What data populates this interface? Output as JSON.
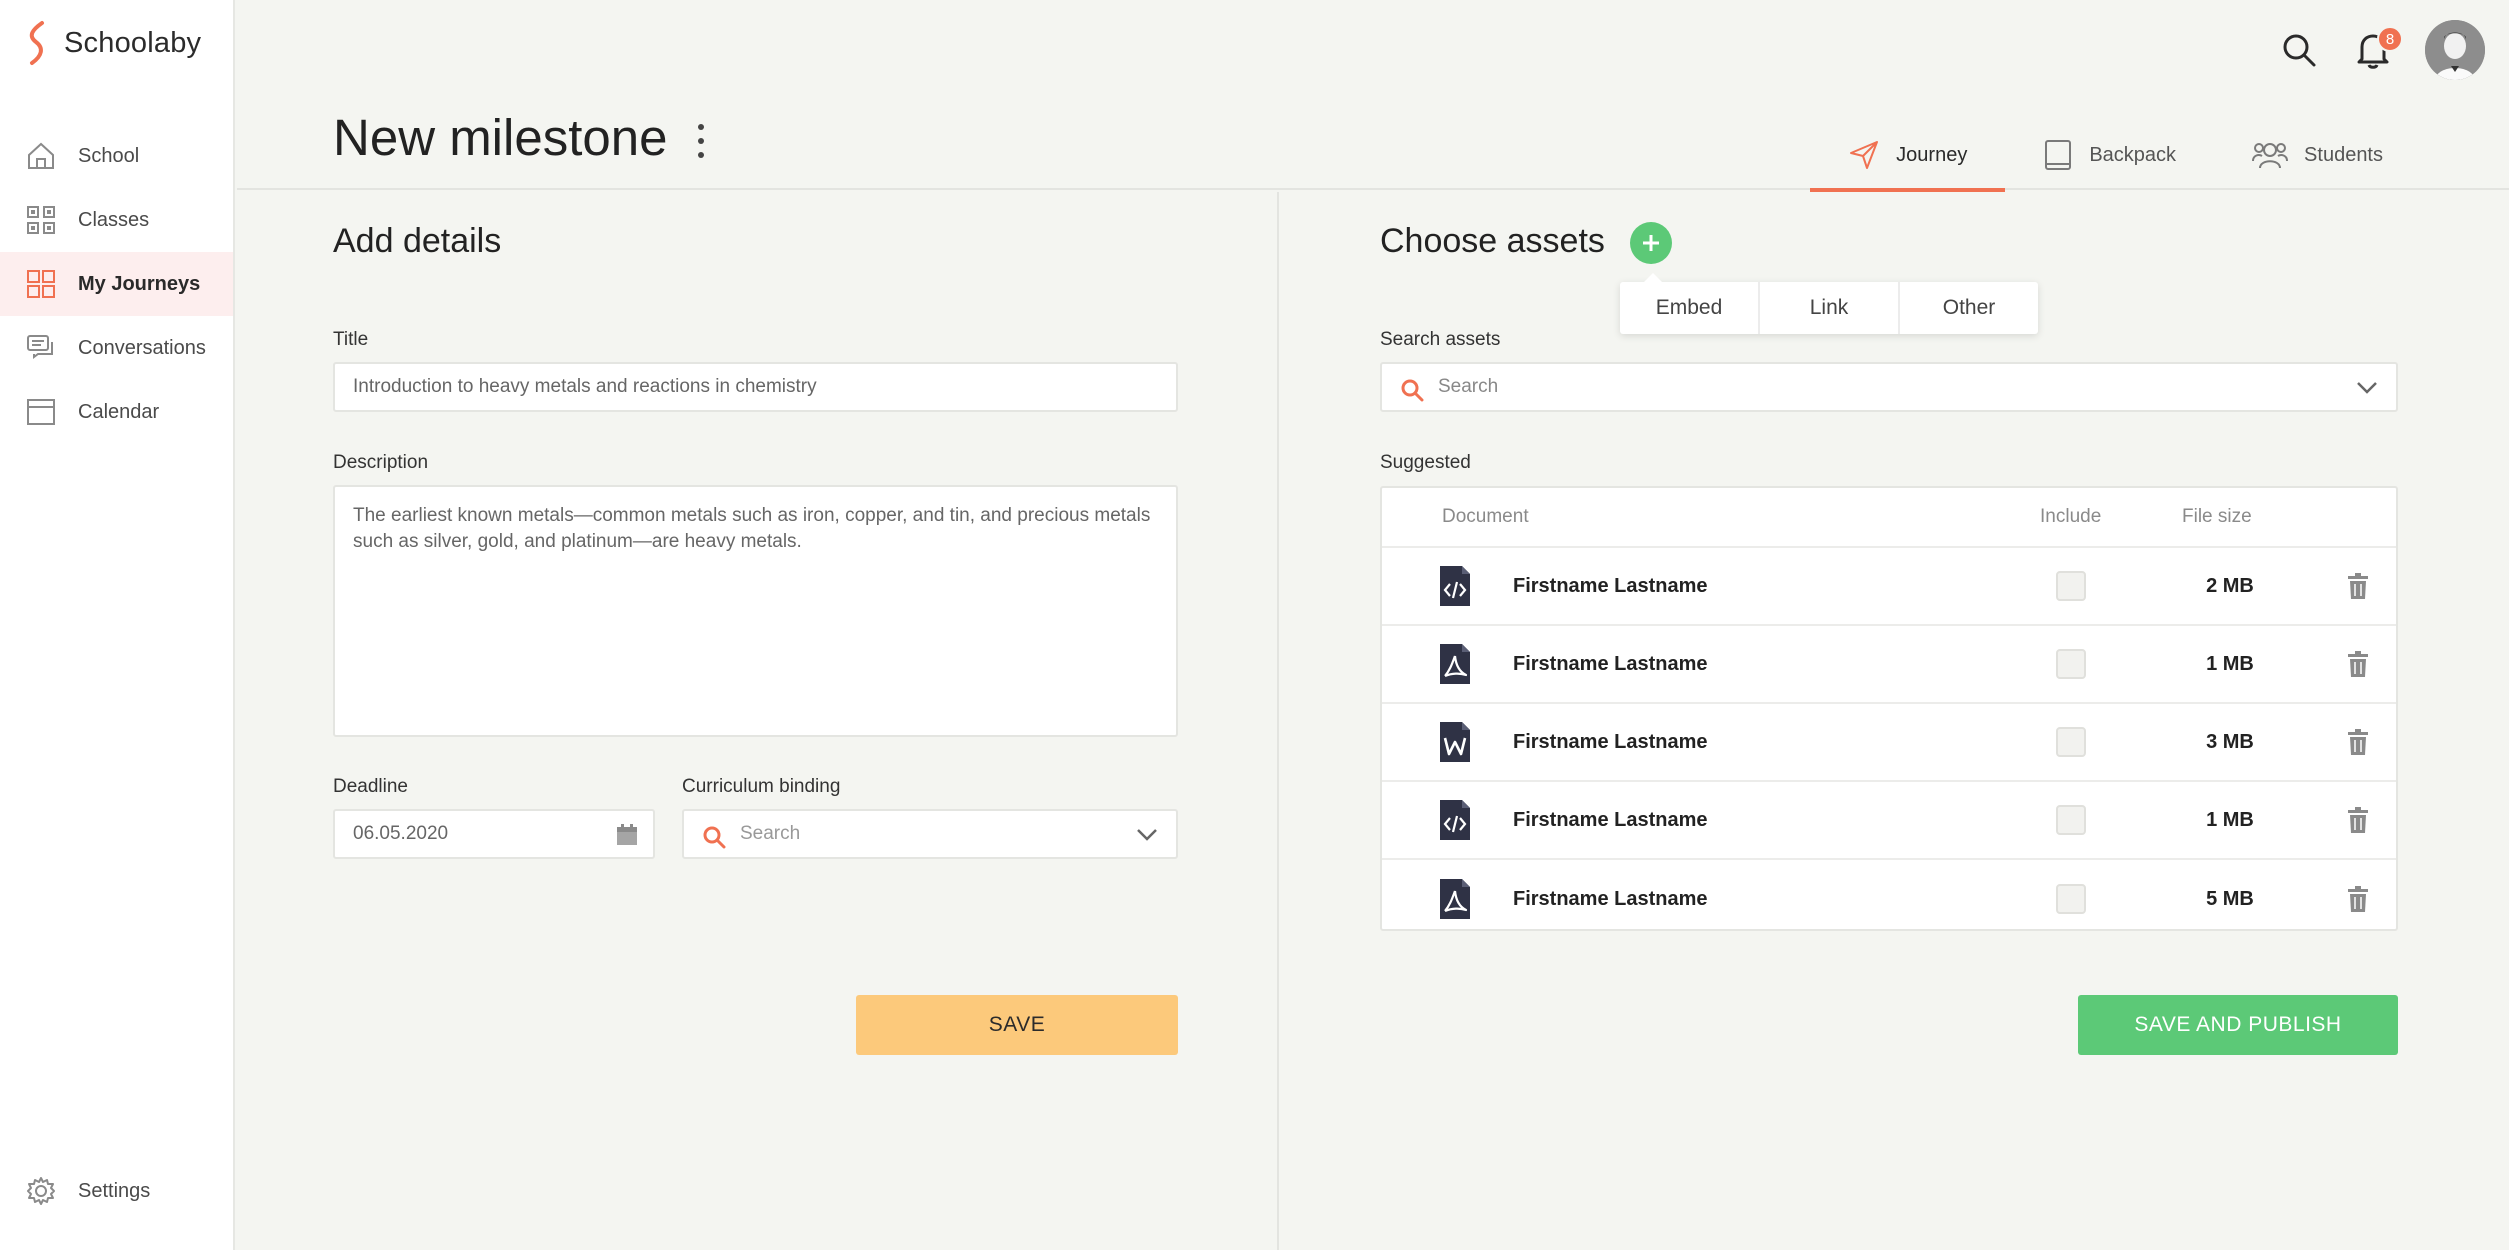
{
  "app": {
    "name": "Schoolaby"
  },
  "sidebar": {
    "items": [
      {
        "label": "School",
        "icon": "home-icon"
      },
      {
        "label": "Classes",
        "icon": "grid-icon"
      },
      {
        "label": "My Journeys",
        "icon": "journeys-icon",
        "active": true
      },
      {
        "label": "Conversations",
        "icon": "chat-icon"
      },
      {
        "label": "Calendar",
        "icon": "calendar-icon"
      }
    ],
    "settings_label": "Settings"
  },
  "header": {
    "title": "New milestone",
    "notification_count": "8",
    "tabs": [
      {
        "label": "Journey",
        "active": true
      },
      {
        "label": "Backpack"
      },
      {
        "label": "Students"
      }
    ]
  },
  "details": {
    "heading": "Add details",
    "title_label": "Title",
    "title_value": "Introduction to heavy metals and reactions in chemistry",
    "description_label": "Description",
    "description_value": "The earliest known metals—common metals such as iron, copper, and tin, and precious metals such as silver, gold, and platinum—are heavy metals.",
    "deadline_label": "Deadline",
    "deadline_value": "06.05.2020",
    "curriculum_label": "Curriculum binding",
    "curriculum_placeholder": "Search",
    "save_label": "SAVE"
  },
  "assets": {
    "heading": "Choose assets",
    "add_menu": [
      "Embed",
      "Link",
      "Other"
    ],
    "search_label": "Search assets",
    "search_placeholder": "Search",
    "suggested_label": "Suggested",
    "columns": {
      "document": "Document",
      "include": "Include",
      "size": "File size"
    },
    "rows": [
      {
        "name": "Firstname Lastname",
        "type": "code",
        "size": "2 MB"
      },
      {
        "name": "Firstname Lastname",
        "type": "pdf",
        "size": "1 MB"
      },
      {
        "name": "Firstname Lastname",
        "type": "word",
        "size": "3 MB"
      },
      {
        "name": "Firstname Lastname",
        "type": "code",
        "size": "1 MB"
      },
      {
        "name": "Firstname Lastname",
        "type": "pdf",
        "size": "5 MB"
      }
    ],
    "publish_label": "SAVE AND PUBLISH"
  },
  "colors": {
    "accent": "#f07151",
    "green": "#5cc977",
    "save_yellow": "#fcc97b",
    "background": "#f4f5f1"
  }
}
